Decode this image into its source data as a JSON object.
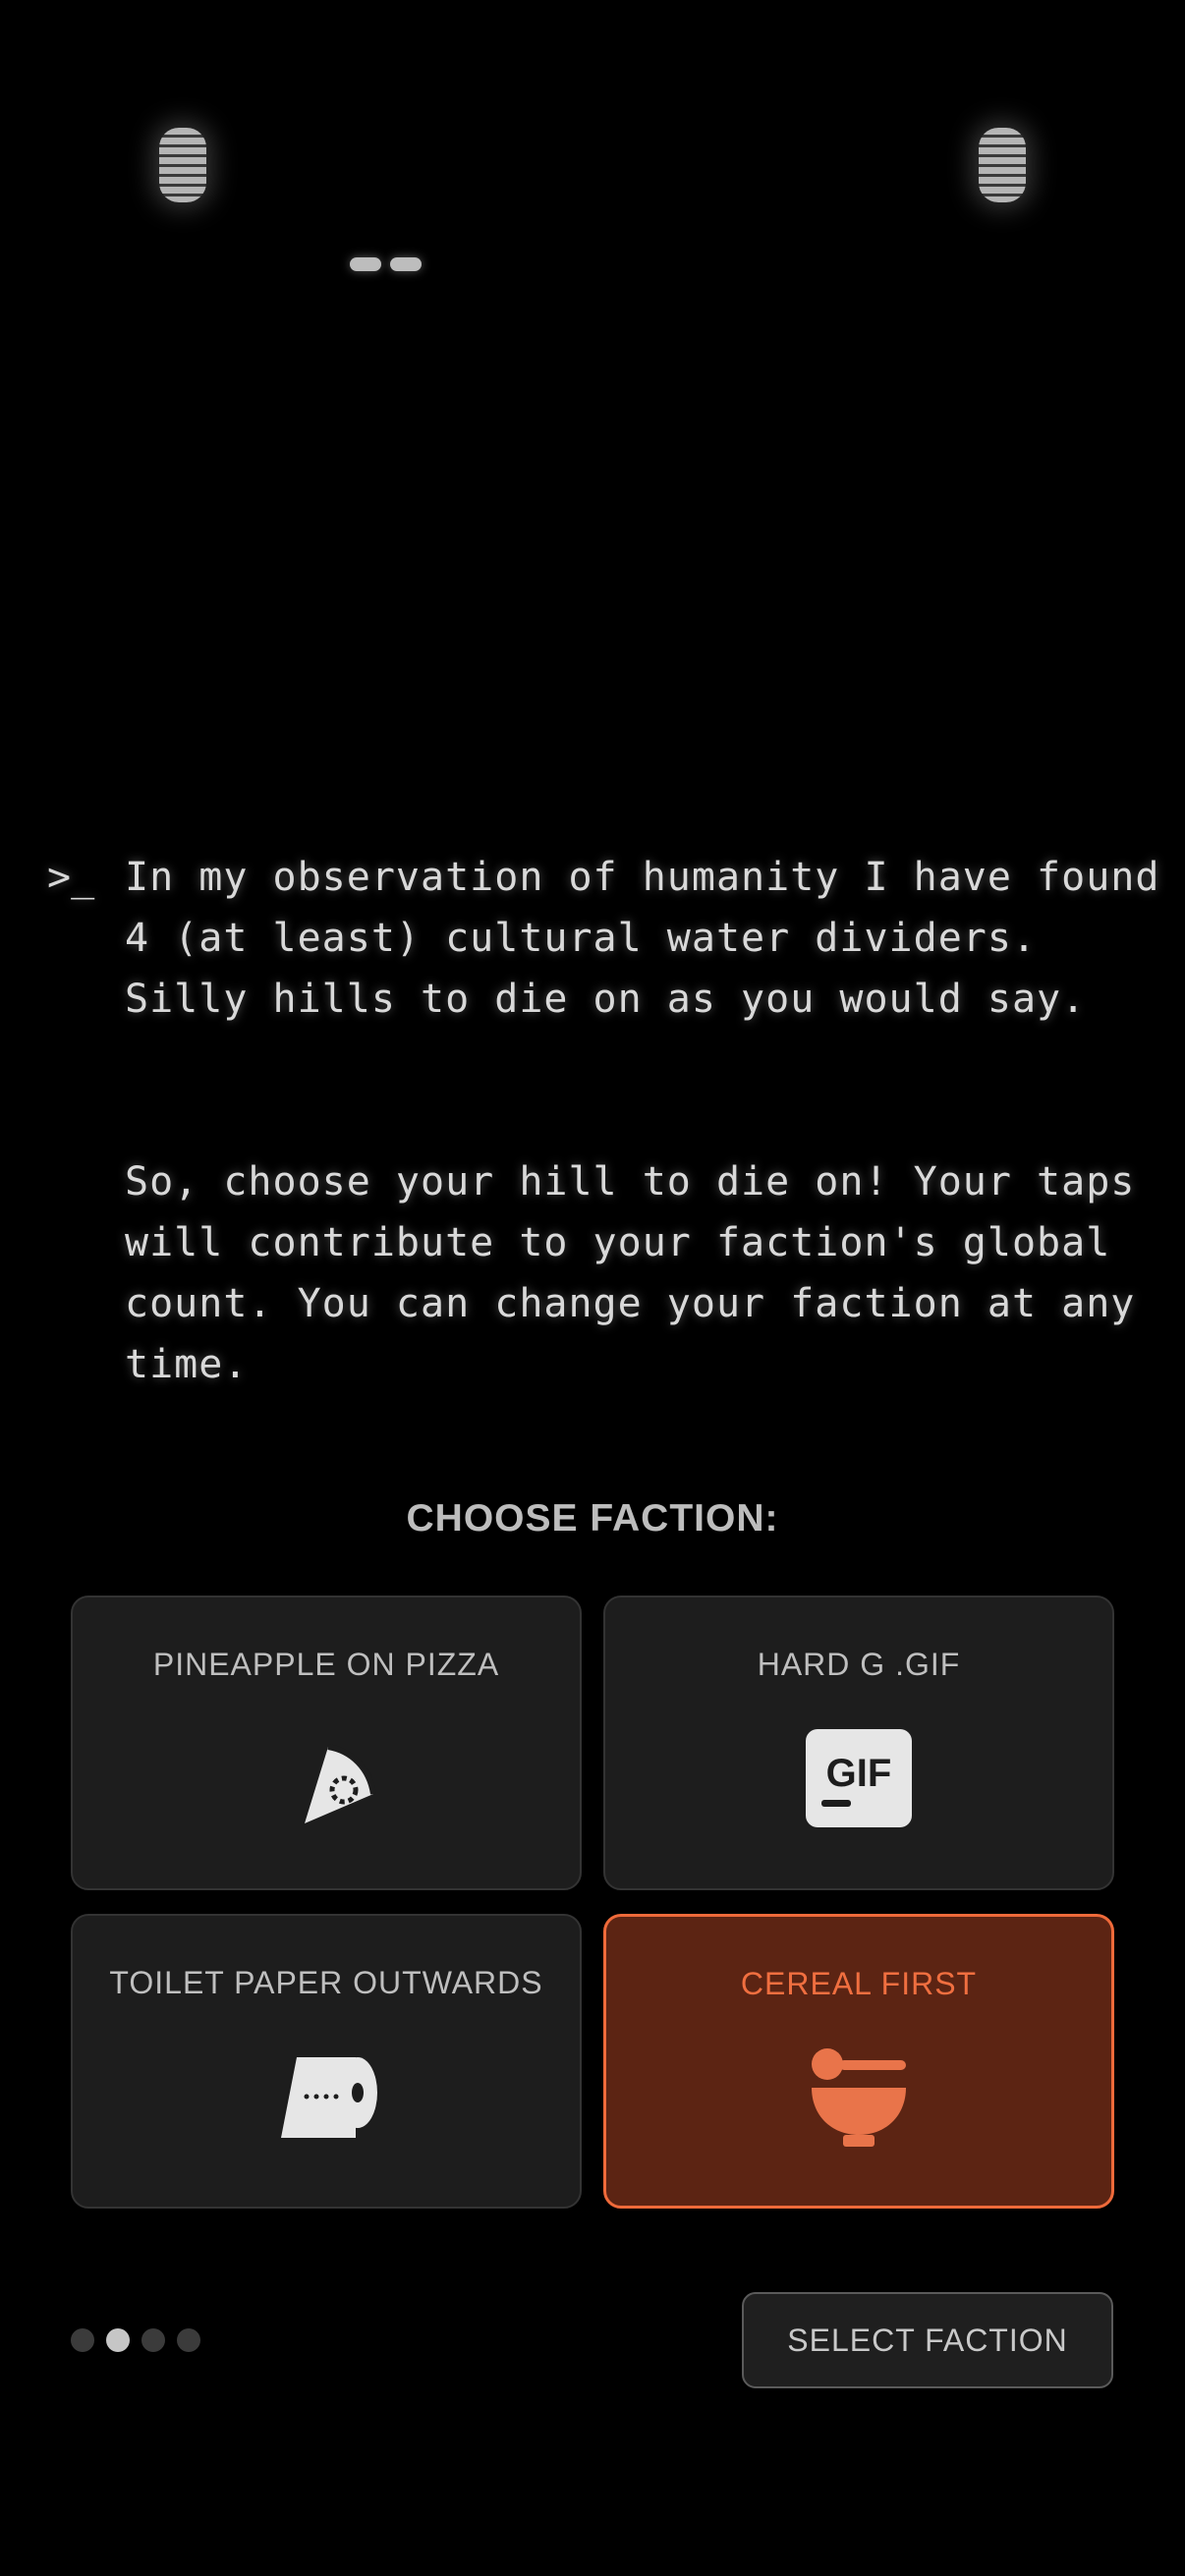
{
  "robot": {
    "left_eye_icon": "eye-grille-icon",
    "right_eye_icon": "eye-grille-icon",
    "mouth_icon": "mouth-icon"
  },
  "terminal": {
    "prompt": ">_",
    "paragraph1": "In my observation of humanity I have found 4 (at least) cultural water dividers. Silly hills to die on as you would say.",
    "paragraph2": "So, choose your hill to die on! Your taps will contribute to your faction's global count. You can change your faction at any time."
  },
  "choose_title": "CHOOSE FACTION:",
  "factions": [
    {
      "label": "PINEAPPLE ON PIZZA",
      "icon": "pizza-slice-icon",
      "selected": false
    },
    {
      "label": "HARD G .GIF",
      "icon": "gif-icon",
      "icon_text": "GIF",
      "selected": false
    },
    {
      "label": "TOILET PAPER OUTWARDS",
      "icon": "toilet-paper-icon",
      "selected": false
    },
    {
      "label": "CEREAL FIRST",
      "icon": "cereal-bowl-icon",
      "selected": true
    }
  ],
  "pager": {
    "total": 4,
    "active_index": 1
  },
  "select_button": "SELECT FACTION",
  "colors": {
    "background": "#000000",
    "card": "#1d1d1d",
    "accent": "#ef6a3a",
    "selected_card": "#5c2413"
  }
}
